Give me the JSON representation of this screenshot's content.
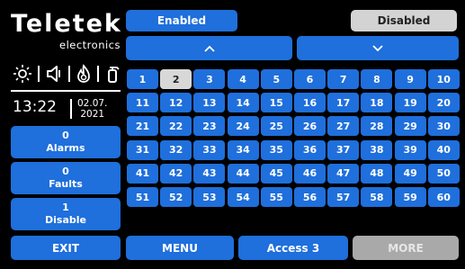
{
  "header": {
    "enabled_label": "Enabled",
    "disabled_label": "Disabled",
    "up_label": "^",
    "down_label": "v"
  },
  "brand": {
    "name": "Teletek",
    "sub": "electronics"
  },
  "status_icons": [
    "sun-icon",
    "speaker-icon",
    "fire-icon",
    "fire-extinguisher-icon"
  ],
  "clock": {
    "time": "13:22",
    "date_day_month": "02.07.",
    "date_year": "2021"
  },
  "counters": [
    {
      "count": "0",
      "label": "Alarms"
    },
    {
      "count": "0",
      "label": "Faults"
    },
    {
      "count": "1",
      "label": "Disable"
    }
  ],
  "grid": {
    "cells": [
      "1",
      "2",
      "3",
      "4",
      "5",
      "6",
      "7",
      "8",
      "9",
      "10",
      "11",
      "12",
      "13",
      "14",
      "15",
      "16",
      "17",
      "18",
      "19",
      "20",
      "21",
      "22",
      "23",
      "24",
      "25",
      "26",
      "27",
      "28",
      "29",
      "30",
      "31",
      "32",
      "33",
      "34",
      "35",
      "36",
      "37",
      "38",
      "39",
      "40",
      "41",
      "42",
      "43",
      "44",
      "45",
      "46",
      "47",
      "48",
      "49",
      "50",
      "51",
      "52",
      "53",
      "54",
      "55",
      "56",
      "57",
      "58",
      "59",
      "60"
    ],
    "selected": "2"
  },
  "footer": {
    "exit_label": "EXIT",
    "menu_label": "MENU",
    "access_label": "Access 3",
    "more_label": "MORE"
  },
  "colors": {
    "button_blue": "#1f6fdc",
    "button_grey": "#d3d3d3",
    "inactive_grey": "#a9a9a9",
    "background": "#000000"
  }
}
